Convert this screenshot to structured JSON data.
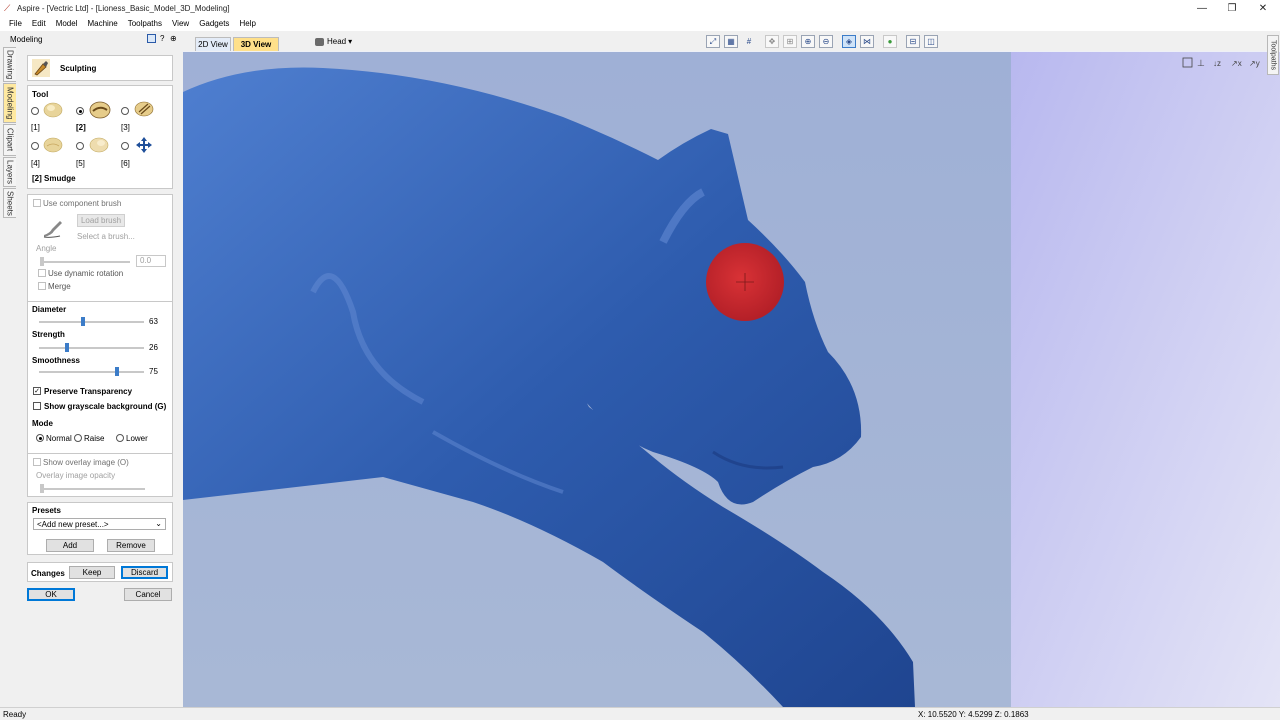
{
  "window": {
    "title": "Aspire - [Vectric Ltd] - [Lioness_Basic_Model_3D_Modeling]",
    "minimize": "—",
    "restore": "❐",
    "close": "✕"
  },
  "menu": [
    "File",
    "Edit",
    "Model",
    "Machine",
    "Toolpaths",
    "View",
    "Gadgets",
    "Help"
  ],
  "panel": {
    "header": "Modeling",
    "side_tabs": [
      "Drawing",
      "Modeling",
      "Clipart",
      "Layers",
      "Sheets"
    ],
    "right_tab": "Toolpaths"
  },
  "sculpting": {
    "title": "Sculpting",
    "tool_heading": "Tool",
    "tools": [
      {
        "label": "[1]",
        "selected": false
      },
      {
        "label": "[2]",
        "selected": true
      },
      {
        "label": "[3]",
        "selected": false
      },
      {
        "label": "[4]",
        "selected": false
      },
      {
        "label": "[5]",
        "selected": false
      },
      {
        "label": "[6]",
        "selected": false
      }
    ],
    "current_tool": "[2] Smudge"
  },
  "brush": {
    "use_component_label": "Use component brush",
    "load_button": "Load brush",
    "select_hint": "Select a brush...",
    "angle_label": "Angle",
    "angle_value": "0.0",
    "dynamic_rotation_label": "Use dynamic rotation",
    "merge_label": "Merge"
  },
  "settings": {
    "diameter_label": "Diameter",
    "diameter_value": "63",
    "diameter_fraction": 0.42,
    "strength_label": "Strength",
    "strength_value": "26",
    "strength_fraction": 0.26,
    "smoothness_label": "Smoothness",
    "smoothness_value": "75",
    "smoothness_fraction": 0.75,
    "preserve_label": "Preserve Transparency",
    "preserve_checked": true,
    "grayscale_label": "Show grayscale background (G)",
    "grayscale_checked": false,
    "mode_label": "Mode",
    "modes": [
      {
        "label": "Normal",
        "selected": true
      },
      {
        "label": "Raise",
        "selected": false
      },
      {
        "label": "Lower",
        "selected": false
      }
    ]
  },
  "overlay": {
    "show_label": "Show overlay image (O)",
    "opacity_label": "Overlay image opacity"
  },
  "presets": {
    "label": "Presets",
    "selected": "<Add new preset...>",
    "add_button": "Add",
    "remove_button": "Remove"
  },
  "changes": {
    "label": "Changes",
    "keep_button": "Keep",
    "discard_button": "Discard"
  },
  "dialog": {
    "ok_button": "OK",
    "cancel_button": "Cancel"
  },
  "view": {
    "tab_2d": "2D View",
    "tab_3d": "3D View",
    "head_dropdown": "Head",
    "colors": {
      "model": "#2f5fb0",
      "background": "#a6b4d4",
      "brush": "#d42020"
    }
  },
  "status": {
    "left": "Ready",
    "coords": "X: 10.5520 Y: 4.5299 Z: 0.1863"
  }
}
